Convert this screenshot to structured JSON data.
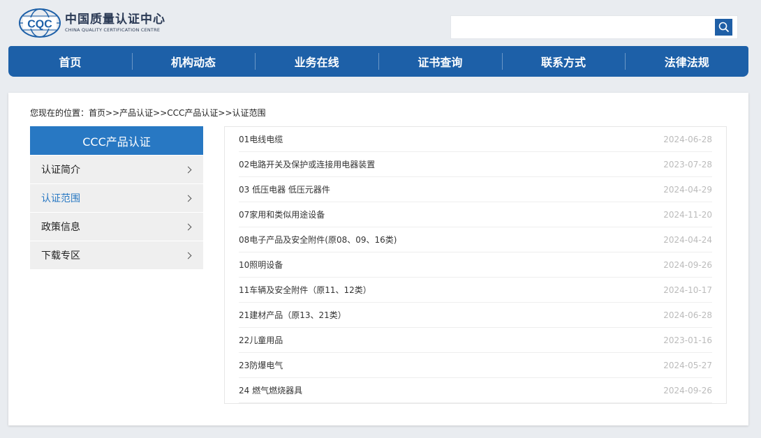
{
  "header": {
    "logo_cn": "中国质量认证中心",
    "logo_en": "CHINA QUALITY CERTIFICATION CENTRE",
    "logo_mark": "CQC",
    "search_placeholder": "",
    "search_icon": "search-icon"
  },
  "nav": [
    "首页",
    "机构动态",
    "业务在线",
    "证书查询",
    "联系方式",
    "法律法规"
  ],
  "breadcrumb": {
    "prefix": "您现在的位置：",
    "items": [
      "首页",
      ">>产品认证",
      ">>CCC产品认证",
      ">>认证范围"
    ]
  },
  "sidebar": {
    "title": "CCC产品认证",
    "items": [
      {
        "label": "认证简介"
      },
      {
        "label": "认证范围",
        "active": true
      },
      {
        "label": "政策信息"
      },
      {
        "label": "下载专区"
      }
    ]
  },
  "list": [
    {
      "title": "01电线电缆",
      "date": "2024-06-28"
    },
    {
      "title": "02电路开关及保护或连接用电器装置",
      "date": "2023-07-28"
    },
    {
      "title": "03 低压电器 低压元器件",
      "date": "2024-04-29"
    },
    {
      "title": "07家用和类似用途设备",
      "date": "2024-11-20"
    },
    {
      "title": "08电子产品及安全附件(原08、09、16类)",
      "date": "2024-04-24"
    },
    {
      "title": "10照明设备",
      "date": "2024-09-26"
    },
    {
      "title": "11车辆及安全附件（原11、12类）",
      "date": "2024-10-17"
    },
    {
      "title": "21建材产品（原13、21类）",
      "date": "2024-06-28"
    },
    {
      "title": "22儿童用品",
      "date": "2023-01-16"
    },
    {
      "title": "23防爆电气",
      "date": "2024-05-27"
    },
    {
      "title": "24 燃气燃烧器具",
      "date": "2024-09-26"
    }
  ],
  "colors": {
    "nav": "#1d60a8",
    "accent": "#2878c3"
  }
}
